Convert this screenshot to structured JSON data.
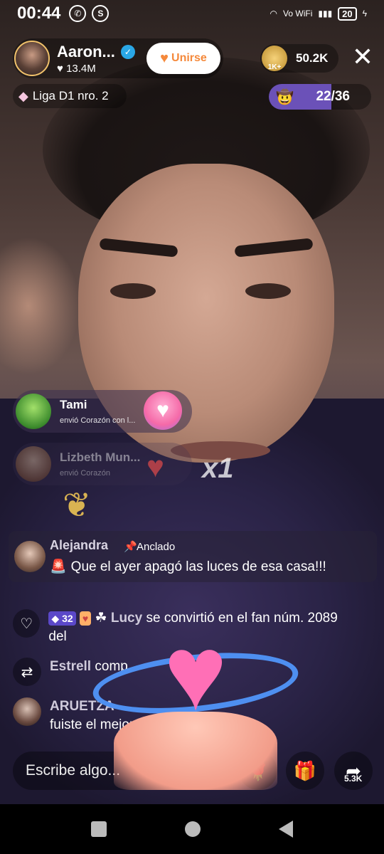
{
  "status_bar": {
    "time": "00:44",
    "battery": "20",
    "network": "Vo WiFi"
  },
  "host": {
    "name": "Aaron...",
    "likes": "♥ 13.4M",
    "join_label": "Unirse"
  },
  "viewers": {
    "badge": "1K+",
    "count": "50.2K"
  },
  "league": {
    "label": "Liga D1 nro. 2"
  },
  "rank": {
    "text": "22/36",
    "progress": 0.61
  },
  "gifts": [
    {
      "user": "Tami",
      "action": "envió Corazón con l..."
    },
    {
      "user": "Lizbeth Mun...",
      "action": "envió Corazón",
      "count": "x1"
    }
  ],
  "pinned": {
    "user": "Alejandra",
    "label": "Anclado",
    "text": "Que el ayer apagó las luces de esa casa!!!"
  },
  "chat": [
    {
      "level": "32",
      "user": "Lucy",
      "text": "se convirtió en el fan núm. 2089 del"
    },
    {
      "user": "Estrell",
      "text": "comp"
    },
    {
      "user": "ARUETZA",
      "text": "fuiste el mejor aron"
    }
  ],
  "input": {
    "placeholder": "Escribe algo..."
  },
  "share": {
    "count": "5.3K"
  },
  "colors": {
    "accent": "#f5893b",
    "rank": "#6b51b8",
    "verified": "#2aa7e6"
  }
}
